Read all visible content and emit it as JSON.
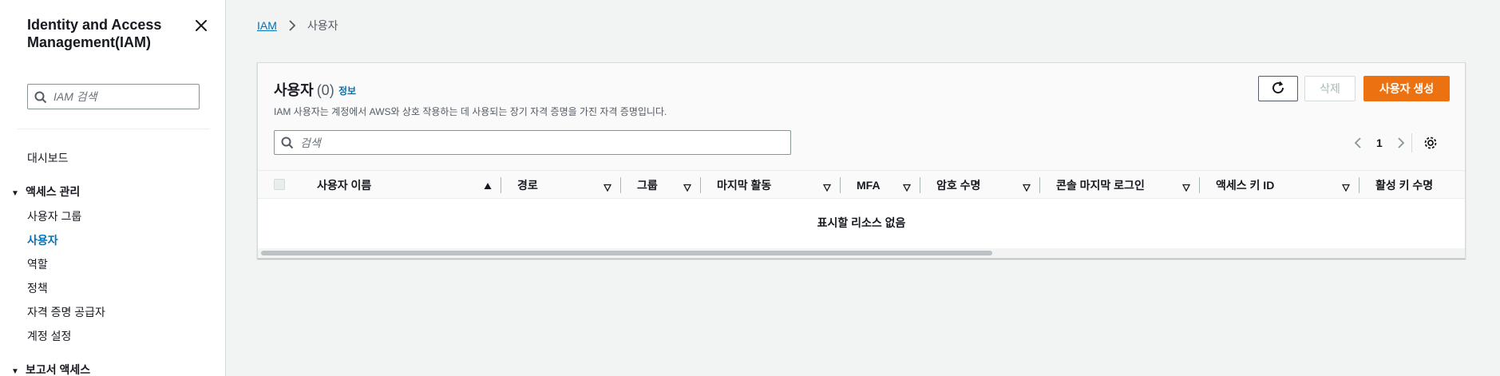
{
  "sidebar": {
    "title": "Identity and Access Management(IAM)",
    "search_placeholder": "IAM 검색",
    "dashboard": "대시보드",
    "section_access": "액세스 관리",
    "items": [
      {
        "label": "사용자 그룹"
      },
      {
        "label": "사용자"
      },
      {
        "label": "역할"
      },
      {
        "label": "정책"
      },
      {
        "label": "자격 증명 공급자"
      },
      {
        "label": "계정 설정"
      }
    ],
    "section_reports": "보고서 액세스"
  },
  "breadcrumb": {
    "root": "IAM",
    "current": "사용자"
  },
  "panel": {
    "title": "사용자",
    "count": "(0)",
    "info": "정보",
    "description": "IAM 사용자는 계정에서 AWS와 상호 작용하는 데 사용되는 장기 자격 증명을 가진 자격 증명입니다.",
    "refresh_icon": "refresh-icon",
    "delete_label": "삭제",
    "create_label": "사용자 생성",
    "search_placeholder": "검색",
    "page": "1",
    "empty_text": "표시할 리소스 없음"
  },
  "table": {
    "columns": [
      {
        "label": "사용자 이름"
      },
      {
        "label": "경로"
      },
      {
        "label": "그룹"
      },
      {
        "label": "마지막 활동"
      },
      {
        "label": "MFA"
      },
      {
        "label": "암호 수명"
      },
      {
        "label": "콘솔 마지막 로그인"
      },
      {
        "label": "액세스 키 ID"
      },
      {
        "label": "활성 키 수명"
      }
    ]
  },
  "colors": {
    "accent": "#0073bb",
    "primary_button": "#ec7211"
  }
}
